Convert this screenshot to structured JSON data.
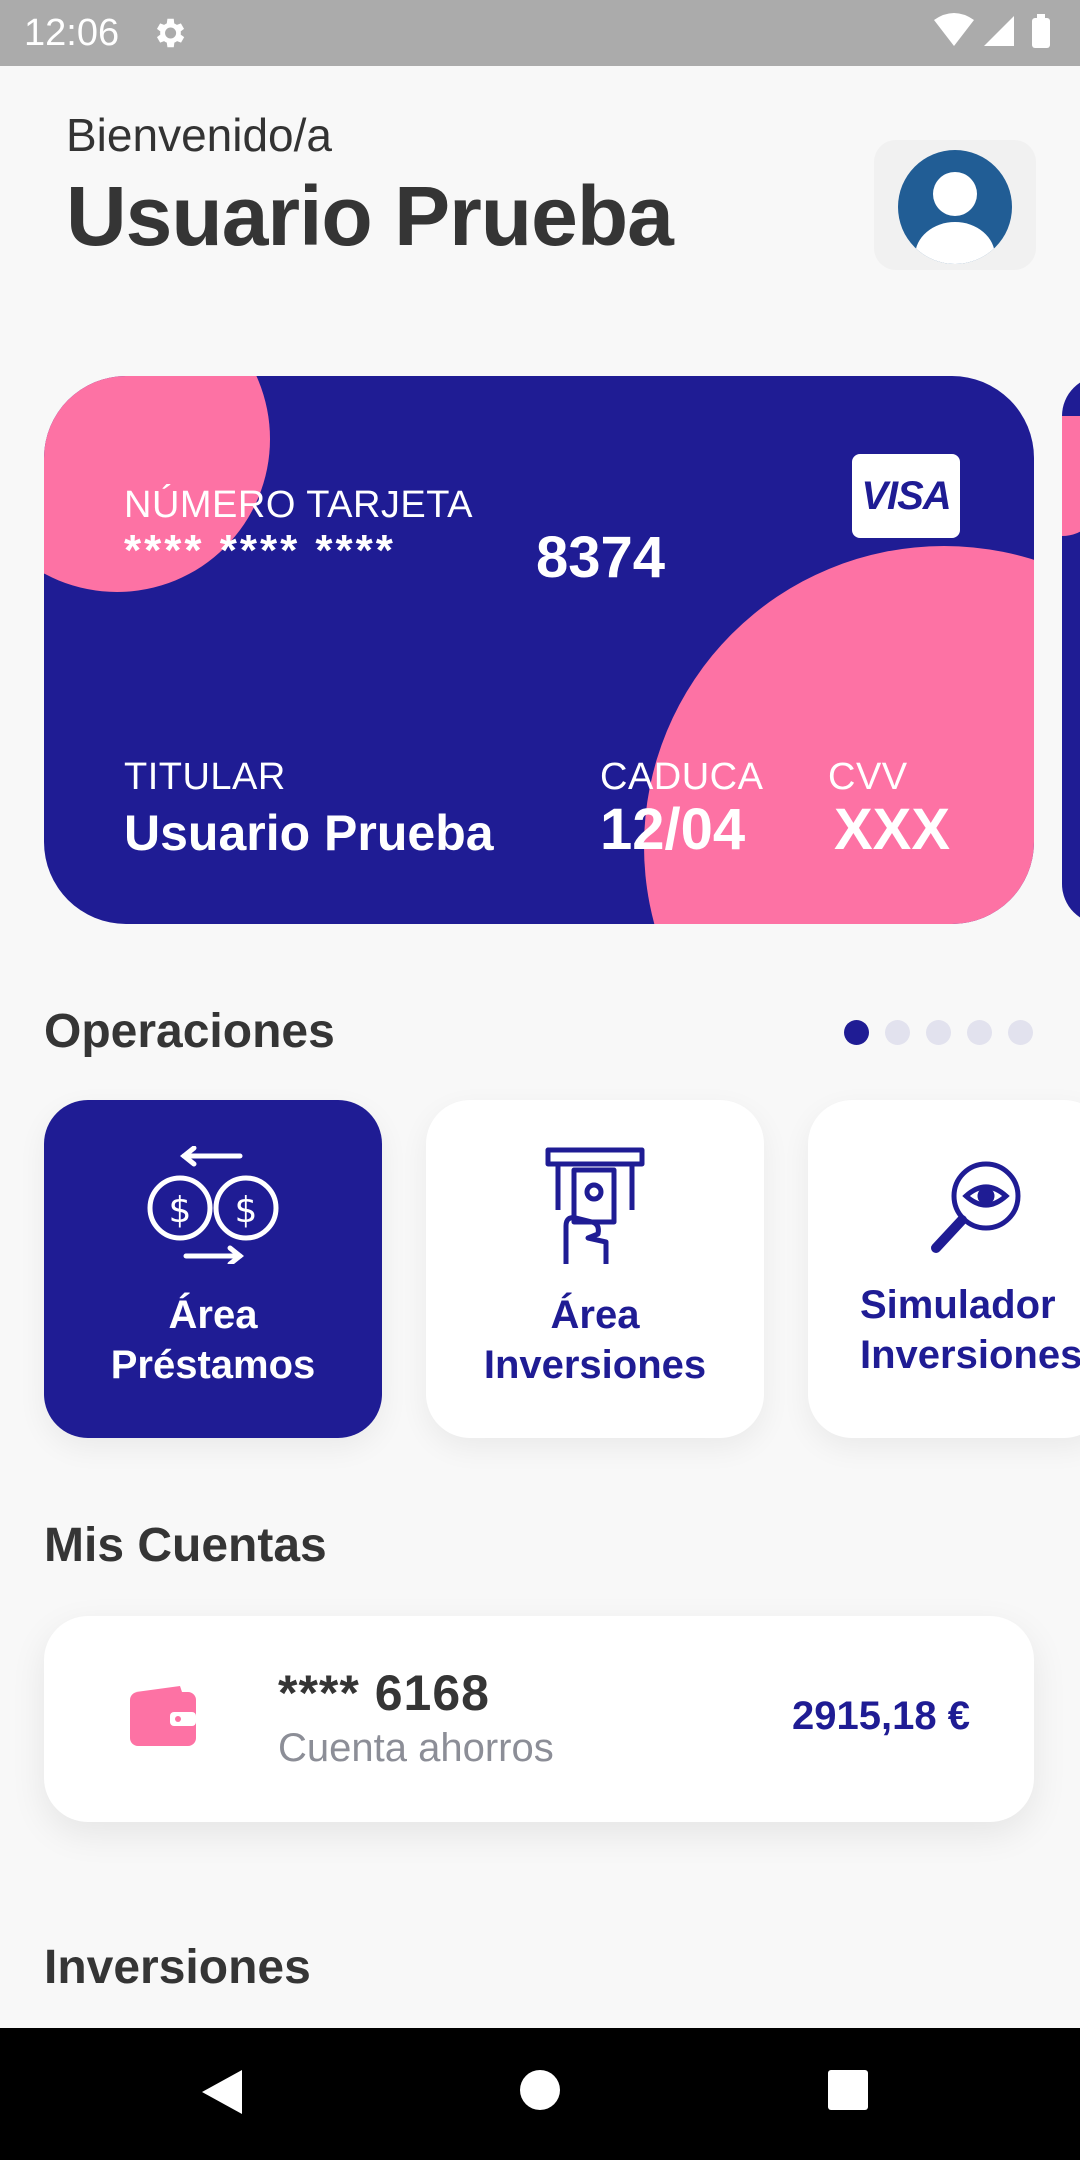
{
  "status_bar": {
    "time": "12:06",
    "icons": [
      "settings-icon",
      "wifi-icon",
      "signal-icon",
      "battery-icon"
    ]
  },
  "header": {
    "welcome": "Bienvenido/a",
    "user_name": "Usuario Prueba",
    "avatar_icon": "avatar-icon"
  },
  "card": {
    "number_label": "NÚMERO TARJETA",
    "number_mask": "**** **** ****",
    "number_last": "8374",
    "brand": "VISA",
    "holder_label": "TITULAR",
    "holder_value": "Usuario Prueba",
    "expiry_label": "CADUCA",
    "expiry_value": "12/04",
    "cvv_label": "CVV",
    "cvv_value": "XXX",
    "pager_total": 5,
    "pager_active": 1
  },
  "operations": {
    "title": "Operaciones",
    "items": [
      {
        "label_line1": "Área",
        "label_line2": "Préstamos",
        "icon": "loan-exchange-icon",
        "active": true
      },
      {
        "label_line1": "Área",
        "label_line2": "Inversiones",
        "icon": "atm-cash-icon",
        "active": false
      },
      {
        "label_line1": "Simulador",
        "label_line2": "Inversiones",
        "icon": "magnifier-eye-icon",
        "active": false
      }
    ]
  },
  "accounts": {
    "title": "Mis Cuentas",
    "items": [
      {
        "number": "**** 6168",
        "type": "Cuenta ahorros",
        "balance": "2915,18 €",
        "icon": "wallet-icon"
      }
    ]
  },
  "investments": {
    "title": "Inversiones"
  },
  "colors": {
    "primary": "#1f1c94",
    "accent": "#fd72a4",
    "background": "#f8f8f8",
    "text_dark": "#353535",
    "text_muted": "#8c8e97"
  },
  "nav_bar": {
    "icons": [
      "back-icon",
      "home-icon",
      "recents-icon"
    ]
  }
}
